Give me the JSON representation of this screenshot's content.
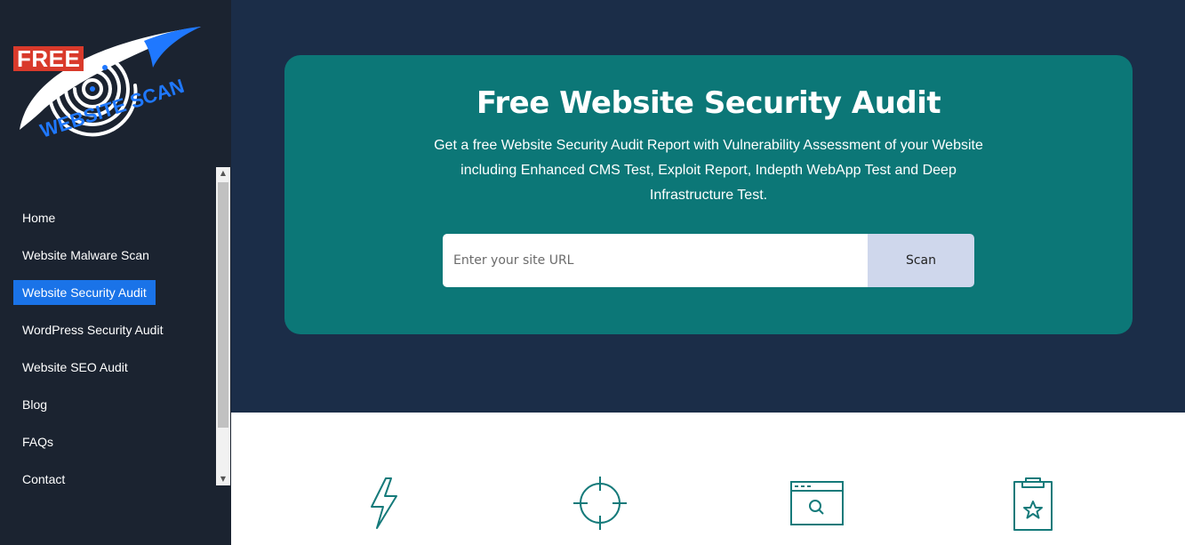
{
  "logo": {
    "badge_text": "FREE",
    "wordmark": "WEBSITE SCAN"
  },
  "sidebar": {
    "items": [
      {
        "label": "Home",
        "active": false
      },
      {
        "label": "Website Malware Scan",
        "active": false
      },
      {
        "label": "Website Security Audit",
        "active": true
      },
      {
        "label": "WordPress Security Audit",
        "active": false
      },
      {
        "label": "Website SEO Audit",
        "active": false
      },
      {
        "label": "Blog",
        "active": false
      },
      {
        "label": "FAQs",
        "active": false
      },
      {
        "label": "Contact",
        "active": false
      }
    ]
  },
  "hero": {
    "title": "Free Website Security Audit",
    "description": "Get a free Website Security Audit Report with Vulnerability Assessment of your Website including Enhanced CMS Test, Exploit Report, Indepth WebApp Test and Deep Infrastructure Test.",
    "search": {
      "placeholder": "Enter your site URL",
      "value": ""
    },
    "scan_button_label": "Scan"
  },
  "features": {
    "icons": [
      "lightning-icon",
      "crosshair-icon",
      "browser-search-icon",
      "clipboard-star-icon"
    ]
  },
  "colors": {
    "sidebar_bg": "#1b2330",
    "hero_bg": "#1b2d48",
    "card_bg": "#0c7777",
    "active_nav": "#1a73e8",
    "scan_button_bg": "#cfd7ec",
    "icon_stroke": "#157a7a",
    "logo_red": "#d93a2b",
    "logo_blue": "#1f78ff"
  }
}
